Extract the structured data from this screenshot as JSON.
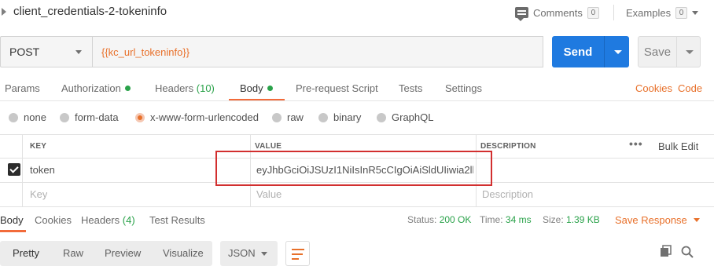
{
  "request": {
    "title": "client_credentials-2-tokeninfo",
    "comments_label": "Comments",
    "comments_count": "0",
    "examples_label": "Examples",
    "examples_count": "0",
    "method": "POST",
    "url": "{{kc_url_tokeninfo}}",
    "send_label": "Send",
    "save_label": "Save"
  },
  "request_tabs": {
    "params": "Params",
    "authorization": "Authorization",
    "headers": "Headers",
    "headers_count": "(10)",
    "body": "Body",
    "prerequest": "Pre-request Script",
    "tests": "Tests",
    "settings": "Settings",
    "cookies": "Cookies",
    "code": "Code",
    "active": "Body"
  },
  "body_types": {
    "none": "none",
    "form_data": "form-data",
    "urlencoded": "x-www-form-urlencoded",
    "raw": "raw",
    "binary": "binary",
    "graphql": "GraphQL",
    "selected": "x-www-form-urlencoded"
  },
  "params_table": {
    "headers": {
      "key": "KEY",
      "value": "VALUE",
      "description": "DESCRIPTION",
      "bulk_edit": "Bulk Edit"
    },
    "rows": [
      {
        "checked": true,
        "key": "token",
        "value": "eyJhbGciOiJSUzI1NiIsInR5cCIgOiAiSldUIiwia2lkIi..."
      }
    ],
    "placeholders": {
      "key": "Key",
      "value": "Value",
      "description": "Description"
    }
  },
  "response": {
    "tabs": {
      "body": "Body",
      "cookies": "Cookies",
      "headers": "Headers",
      "headers_count": "(4)",
      "test_results": "Test Results"
    },
    "status_label": "Status:",
    "status_value": "200 OK",
    "time_label": "Time:",
    "time_value": "34 ms",
    "size_label": "Size:",
    "size_value": "1.39 KB",
    "save_response": "Save Response",
    "views": {
      "pretty": "Pretty",
      "raw": "Raw",
      "preview": "Preview",
      "visualize": "Visualize",
      "active": "Pretty"
    },
    "format": "JSON"
  },
  "colors": {
    "accent": "#f26b3a",
    "send_blue": "#1f7ae0",
    "success_green": "#2aa24a",
    "highlight_red": "#d22f2f"
  },
  "icons": [
    "caret-right-icon",
    "comment-icon",
    "chevron-down-icon",
    "checkbox-checked-icon",
    "more-dots-icon",
    "wrap-lines-icon",
    "copy-icon",
    "search-icon"
  ]
}
